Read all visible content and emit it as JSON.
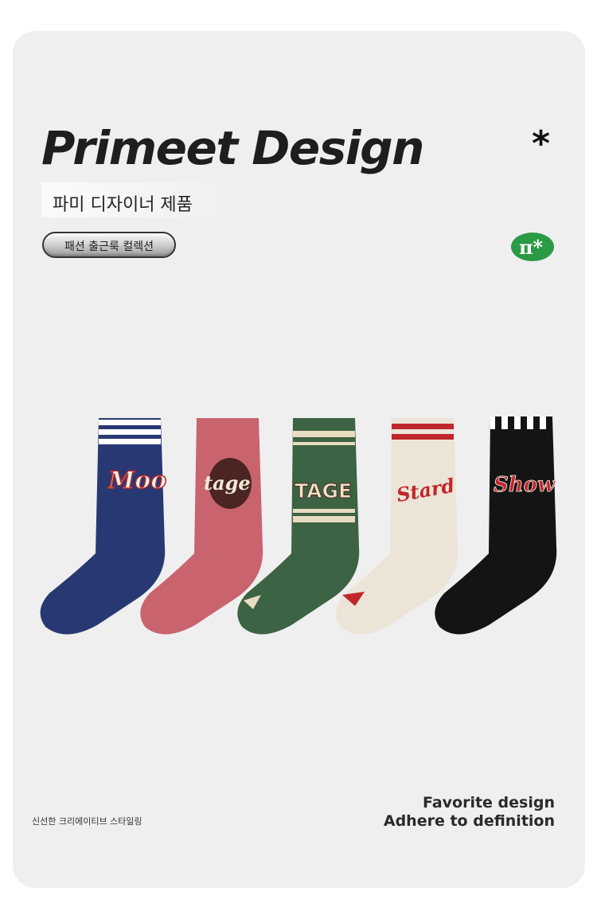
{
  "header": {
    "title": "Primeet Design",
    "asterisk": "*",
    "subtitle": "파미 디자이너 제품",
    "badge_label": "패션 출근룩 컬렉션",
    "logo_text": "π*"
  },
  "products": {
    "socks": [
      {
        "label": "Moo",
        "color": "#283873"
      },
      {
        "label": "tage",
        "color": "#c9646f"
      },
      {
        "label": "TAGE",
        "color": "#3c6343"
      },
      {
        "label": "Stard",
        "color": "#ece5d7"
      },
      {
        "label": "Show",
        "color": "#141414"
      }
    ]
  },
  "footer": {
    "left_text": "신선한 크리에이티브 스타일링",
    "right_line1": "Favorite design",
    "right_line2": "Adhere to definition"
  },
  "colors": {
    "card_background": "#efefef",
    "logo_green": "#2a9a45",
    "accent_red": "#c0262c"
  }
}
